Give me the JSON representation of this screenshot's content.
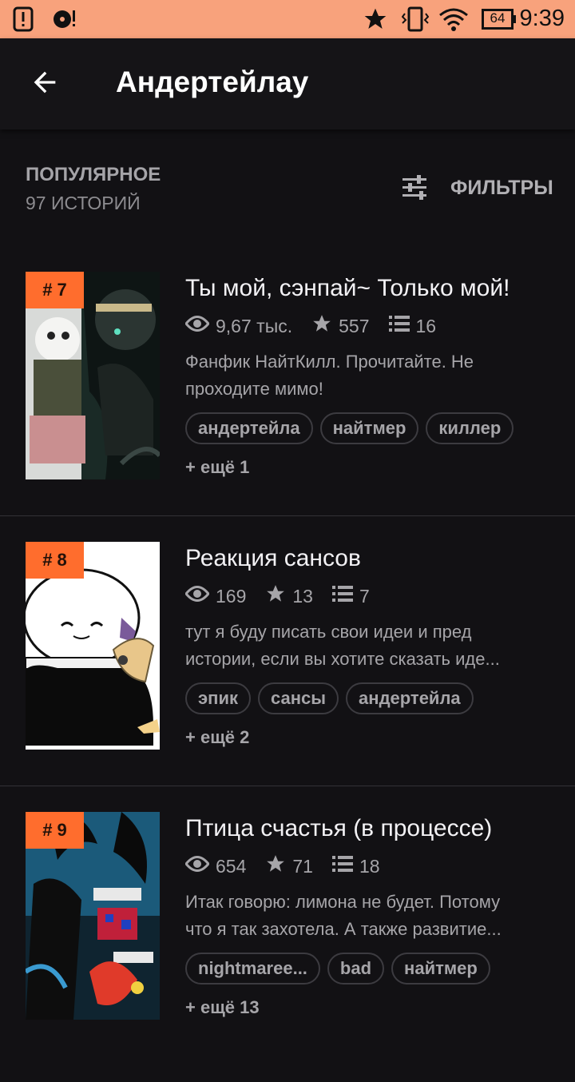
{
  "status_bar": {
    "time": "9:39",
    "battery": "64",
    "icons": [
      "alert-icon",
      "music-icon",
      "star-icon",
      "vibrate-icon",
      "wifi-icon",
      "battery-icon"
    ]
  },
  "appbar": {
    "title": "Андертейлау",
    "back_icon": "arrow-back-icon"
  },
  "list_header": {
    "title": "ПОПУЛЯРНОЕ",
    "count": "97 ИСТОРИЙ",
    "filters_label": "ФИЛЬТРЫ",
    "filters_icon": "sliders-icon"
  },
  "stories": [
    {
      "rank": "# 7",
      "title": "Ты мой, сэнпай~ Только мой!",
      "views": "9,67 тыс.",
      "votes": "557",
      "parts": "16",
      "desc_line1": "Фанфик НайтКилл. Прочитайте. Не",
      "desc_line2": "проходите мимо!",
      "tags": [
        "андертейла",
        "найтмер",
        "киллер"
      ],
      "more": "+ ещё 1"
    },
    {
      "rank": "# 8",
      "title": "Реакция сансов",
      "views": "169",
      "votes": "13",
      "parts": "7",
      "desc_line1": "тут я буду писать свои идеи и пред",
      "desc_line2": "истории, если вы хотите сказать иде...",
      "tags": [
        "эпик",
        "сансы",
        "андертейла"
      ],
      "more": "+ ещё 2"
    },
    {
      "rank": "# 9",
      "title": "Птица счастья (в процессе)",
      "views": "654",
      "votes": "71",
      "parts": "18",
      "desc_line1": "Итак  говорю: лимона не будет. Потому",
      "desc_line2": "что я так захотела. А также развитие...",
      "tags": [
        "nightmaree...",
        "bad",
        "найтмер"
      ],
      "more": "+ ещё 13"
    }
  ],
  "colors": {
    "status_bar": "#f8a27c",
    "background": "#121114",
    "rank_badge": "#ff6d2d",
    "text_primary": "#f2f1f4",
    "text_secondary": "#a6a5a9"
  }
}
